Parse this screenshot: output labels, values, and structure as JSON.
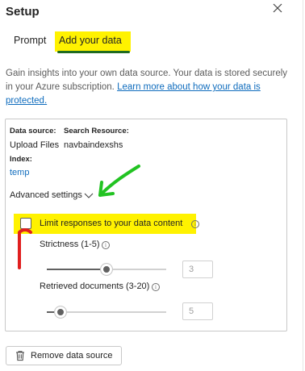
{
  "panel": {
    "title": "Setup",
    "close_icon": "close-icon"
  },
  "tabs": {
    "prompt": "Prompt",
    "add_data": "Add your data",
    "active": "add_data"
  },
  "description": {
    "text": "Gain insights into your own data source. Your data is stored securely in your Azure subscription. ",
    "link": "Learn more about how your data is protected."
  },
  "data_card": {
    "data_source_label": "Data source:",
    "data_source_value": "Upload Files",
    "search_resource_label": "Search Resource:",
    "search_resource_value": "navbaindexshs",
    "index_label": "Index:",
    "index_value": "temp"
  },
  "advanced": {
    "label": "Advanced settings",
    "chevron_icon": "chevron-down-icon",
    "limit_label": "Limit responses to your data content",
    "limit_checked": false,
    "strictness": {
      "label": "Strictness (1-5)",
      "value": "3",
      "fraction": 0.5
    },
    "retrieved": {
      "label": "Retrieved documents (3-20)",
      "value": "5",
      "fraction": 0.118
    }
  },
  "remove_button": {
    "label": "Remove data source",
    "icon": "trash-icon"
  },
  "annotations": {
    "highlight_color": "#fff200",
    "green_arrow_color": "#22c322",
    "red_arrow_color": "#e01f1f"
  }
}
